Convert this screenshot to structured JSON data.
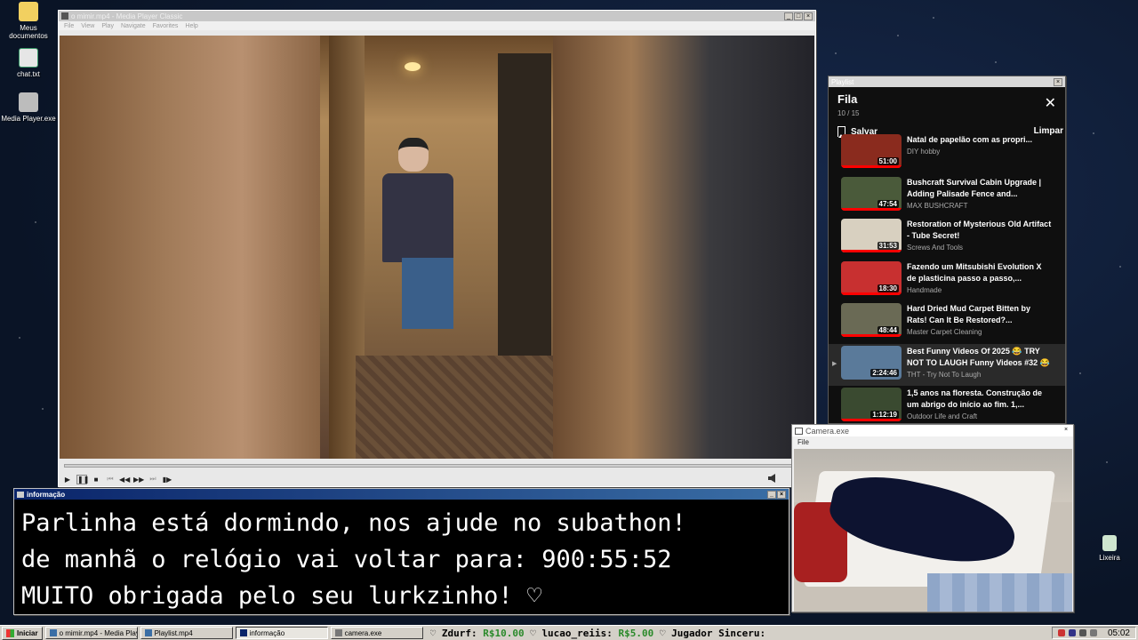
{
  "desktop": {
    "icons": [
      {
        "label": "Meus documentos"
      },
      {
        "label": "chat.txt"
      },
      {
        "label": "Media Player.exe"
      },
      {
        "label": "Lixeira"
      }
    ]
  },
  "media_player": {
    "title": "o mimir.mp4 - Media Player Classic",
    "menu": [
      "File",
      "View",
      "Play",
      "Navigate",
      "Favorites",
      "Help"
    ],
    "controls": [
      "▶",
      "❚❚",
      "■",
      "⏮",
      "◀◀",
      "▶▶",
      "⏭",
      "▮▶"
    ],
    "volume_icon": "speaker-icon"
  },
  "info_window": {
    "title": "informação",
    "lines": [
      "Parlinha está dormindo, nos ajude no subathon!",
      "de manhã o relógio vai voltar para:  900:55:52",
      "MUITO obrigada pelo seu lurkzinho! ♡"
    ]
  },
  "playlist": {
    "window_title": "Playlist",
    "heading": "Fila",
    "count": "10 / 15",
    "save_label": "Salvar",
    "clear_label": "Limpar",
    "items": [
      {
        "title": "Natal de papelão com as propri...",
        "channel": "DIY hobby",
        "duration": "51:00",
        "thumb_color": "#8a2b1e",
        "progress": 1.0
      },
      {
        "title": "Bushcraft Survival Cabin Upgrade | Adding Palisade Fence and...",
        "channel": "MAX BUSHCRAFT",
        "duration": "47:54",
        "thumb_color": "#4a5a3a",
        "progress": 1.0
      },
      {
        "title": "Restoration of Mysterious Old Artifact - Tube Secret!",
        "channel": "Screws And Tools",
        "duration": "31:53",
        "thumb_color": "#d8d0c0",
        "progress": 1.0
      },
      {
        "title": "Fazendo um Mitsubishi Evolution X de plasticina passo a passo,...",
        "channel": "Handmade",
        "duration": "18:30",
        "thumb_color": "#c83030",
        "progress": 1.0
      },
      {
        "title": "Hard Dried Mud Carpet Bitten by Rats! Can It Be Restored?...",
        "channel": "Master Carpet Cleaning",
        "duration": "48:44",
        "thumb_color": "#6a6a55",
        "progress": 1.0
      },
      {
        "title": "Best Funny Videos Of 2025 😂 TRY NOT TO LAUGH Funny Videos #32 😂",
        "channel": "THT - Try Not To Laugh",
        "duration": "2:24:46",
        "thumb_color": "#5a7a9a",
        "progress": 0.0,
        "active": true
      },
      {
        "title": "1,5 anos na floresta. Construção de um abrigo do início ao fim. 1,...",
        "channel": "Outdoor Life and Craft",
        "duration": "1:12:19",
        "thumb_color": "#3a4a30",
        "progress": 1.0
      }
    ]
  },
  "camera": {
    "title": "Camera.exe",
    "menu": [
      "File"
    ]
  },
  "taskbar": {
    "start_label": "Iniciar",
    "tasks": [
      {
        "label": "o mimir.mp4 - Media Playe..."
      },
      {
        "label": "Playlist.mp4"
      },
      {
        "label": "informação",
        "active": true
      },
      {
        "label": "camera.exe"
      }
    ],
    "ticker": [
      {
        "name": "Zdurf:",
        "amount": "R$10.00"
      },
      {
        "name": "lucao_reiis:",
        "amount": "R$5.00"
      },
      {
        "name": "Jugador Sinceru:",
        "amount": ""
      }
    ],
    "clock": "05:02"
  },
  "colors": {
    "desktop_bg": "#0a1426",
    "info_bg": "#000000",
    "info_text": "#ffffff",
    "playlist_bg": "#0f0f0f",
    "progress_red": "#ff0000",
    "donation_green": "#2a8a2a"
  }
}
